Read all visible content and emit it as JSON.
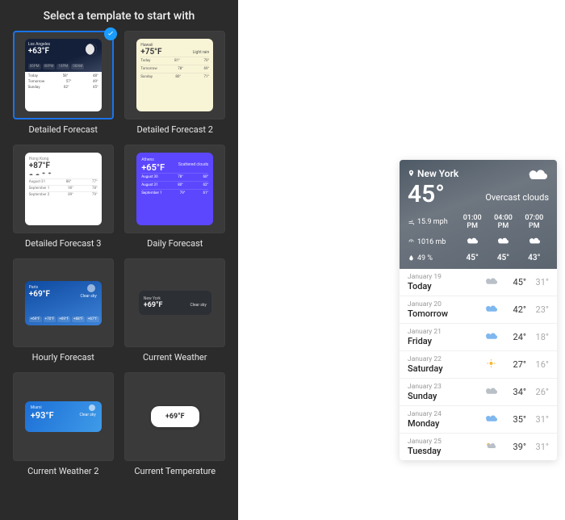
{
  "panel": {
    "title": "Select a template to start with",
    "templates": [
      {
        "label": "Detailed Forecast",
        "selected": true,
        "thumb": {
          "kind": "detailed1",
          "location": "Los Angeles",
          "temp": "+63°F",
          "hours": [
            "06PM",
            "08PM",
            "10PM",
            "00AM"
          ],
          "rows": [
            {
              "name": "Today",
              "hi": "58°",
              "lo": "48°"
            },
            {
              "name": "Tomorrow",
              "hi": "57°",
              "lo": "49°"
            },
            {
              "name": "Sunday",
              "hi": "62°",
              "lo": "45°"
            }
          ]
        }
      },
      {
        "label": "Detailed Forecast 2",
        "selected": false,
        "thumb": {
          "kind": "detailed2",
          "location": "Hawaii",
          "temp": "+75°F",
          "cond": "Light rain",
          "rows": [
            {
              "name": "Today",
              "hi": "81°",
              "lo": "70°"
            },
            {
              "name": "Tomorrow",
              "hi": "78°",
              "lo": "69°"
            },
            {
              "name": "Sunday",
              "hi": "80°",
              "lo": "71°"
            }
          ]
        }
      },
      {
        "label": "Detailed Forecast 3",
        "selected": false,
        "thumb": {
          "kind": "detailed3",
          "location": "Hong Kong",
          "temp": "+87°F",
          "rows": [
            {
              "name": "August 31",
              "hi": "88°",
              "lo": "77°"
            },
            {
              "name": "September 1",
              "hi": "90°",
              "lo": "78°"
            },
            {
              "name": "September 2",
              "hi": "89°",
              "lo": "79°"
            }
          ]
        }
      },
      {
        "label": "Daily Forecast",
        "selected": false,
        "thumb": {
          "kind": "daily",
          "location": "Athens",
          "temp": "+65°F",
          "cond": "Scattered clouds",
          "rows": [
            {
              "name": "August 30",
              "hi": "78°",
              "lo": "60°"
            },
            {
              "name": "August 31",
              "hi": "80°",
              "lo": "62°"
            },
            {
              "name": "September 1",
              "hi": "79°",
              "lo": "61°"
            }
          ]
        }
      },
      {
        "label": "Hourly Forecast",
        "selected": false,
        "thumb": {
          "kind": "hourly",
          "location": "Paris",
          "temp": "+69°F",
          "cond": "Clear sky",
          "hours": [
            "+69°F",
            "+70°F",
            "+69°F",
            "+68°F",
            "+67°F"
          ]
        }
      },
      {
        "label": "Current Weather",
        "selected": false,
        "thumb": {
          "kind": "current",
          "location": "New York",
          "temp": "+69°F",
          "cond": "Clear sky"
        }
      },
      {
        "label": "Current Weather 2",
        "selected": false,
        "thumb": {
          "kind": "current2",
          "location": "Miami",
          "temp": "+93°F",
          "cond": "Clear sky"
        }
      },
      {
        "label": "Current Temperature",
        "selected": false,
        "thumb": {
          "kind": "temp",
          "temp": "+69°F"
        }
      }
    ]
  },
  "preview": {
    "location": "New York",
    "temp": "45°",
    "condition": "Overcast clouds",
    "wind": "15.9 mph",
    "pressure": "1016 mb",
    "humidity": "49 %",
    "hours": [
      {
        "time": "01:00 PM",
        "temp": "45°",
        "icon": "cloud"
      },
      {
        "time": "04:00 PM",
        "temp": "45°",
        "icon": "cloud"
      },
      {
        "time": "07:00 PM",
        "temp": "43°",
        "icon": "cloud"
      }
    ],
    "days": [
      {
        "date": "January 19",
        "name": "Today",
        "hi": "45°",
        "lo": "31°",
        "icon": "cloud-grey"
      },
      {
        "date": "January 20",
        "name": "Tomorrow",
        "hi": "42°",
        "lo": "23°",
        "icon": "cloud-blue"
      },
      {
        "date": "January 21",
        "name": "Friday",
        "hi": "24°",
        "lo": "18°",
        "icon": "cloud-blue"
      },
      {
        "date": "January 22",
        "name": "Saturday",
        "hi": "27°",
        "lo": "16°",
        "icon": "sun"
      },
      {
        "date": "January 23",
        "name": "Sunday",
        "hi": "34°",
        "lo": "26°",
        "icon": "cloud-grey"
      },
      {
        "date": "January 24",
        "name": "Monday",
        "hi": "35°",
        "lo": "31°",
        "icon": "cloud-blue"
      },
      {
        "date": "January 25",
        "name": "Tuesday",
        "hi": "39°",
        "lo": "31°",
        "icon": "part-sun"
      }
    ]
  }
}
